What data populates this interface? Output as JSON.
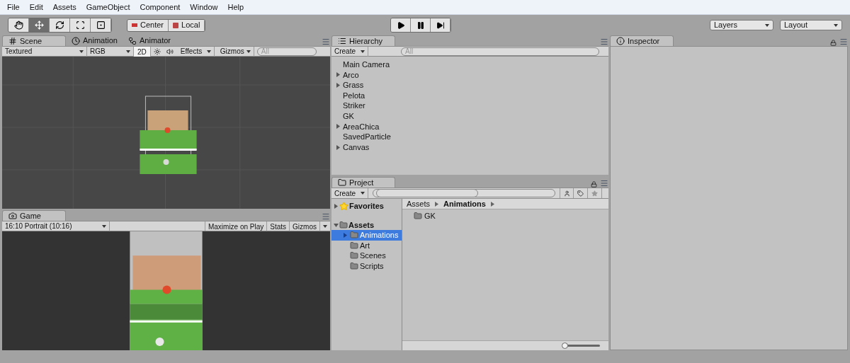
{
  "menu": [
    "File",
    "Edit",
    "Assets",
    "GameObject",
    "Component",
    "Window",
    "Help"
  ],
  "tools": [
    {
      "kind": "hand",
      "selected": false
    },
    {
      "kind": "move",
      "selected": true
    },
    {
      "kind": "rotate",
      "selected": false
    },
    {
      "kind": "scale",
      "selected": false
    },
    {
      "kind": "rect",
      "selected": false
    }
  ],
  "pivot": [
    {
      "kind": "center",
      "label": "Center"
    },
    {
      "kind": "local",
      "label": "Local"
    }
  ],
  "playback": [
    {
      "kind": "play"
    },
    {
      "kind": "pause"
    },
    {
      "kind": "step"
    }
  ],
  "layers": "Layers",
  "layout": "Layout",
  "scene_panel": {
    "tabs": [
      {
        "kind": "scene",
        "label": "Scene",
        "selected": true
      },
      {
        "kind": "animation",
        "label": "Animation",
        "selected": false
      },
      {
        "kind": "animator",
        "label": "Animator",
        "selected": false
      }
    ],
    "draw_mode": "Textured",
    "render_mode": "RGB",
    "mode_2d": {
      "label": "2D",
      "on": true
    },
    "effects": "Effects",
    "gizmos": "Gizmos",
    "search_placeholder": "All"
  },
  "game_panel": {
    "tab": "Game",
    "aspect": "16:10 Portrait (10:16)",
    "buttons": [
      "Maximize on Play",
      "Stats",
      "Gizmos"
    ]
  },
  "hierarchy": {
    "tab": "Hierarchy",
    "create": "Create",
    "search_placeholder": "All",
    "items": [
      {
        "label": "Main Camera",
        "has_children": false
      },
      {
        "label": "Arco",
        "has_children": true
      },
      {
        "label": "Grass",
        "has_children": true
      },
      {
        "label": "Pelota",
        "has_children": false
      },
      {
        "label": "Striker",
        "has_children": false
      },
      {
        "label": "GK",
        "has_children": false
      },
      {
        "label": "AreaChica",
        "has_children": true
      },
      {
        "label": "SavedParticle",
        "has_children": false
      },
      {
        "label": "Canvas",
        "has_children": true
      }
    ]
  },
  "project": {
    "tab": "Project",
    "create": "Create",
    "favorites": {
      "label": "Favorites",
      "expanded": false
    },
    "assets": {
      "label": "Assets",
      "expanded": true,
      "children": [
        {
          "label": "Animations",
          "selected": true,
          "has_children": true
        },
        {
          "label": "Art",
          "selected": false,
          "has_children": false
        },
        {
          "label": "Scenes",
          "selected": false,
          "has_children": false
        },
        {
          "label": "Scripts",
          "selected": false,
          "has_children": false
        }
      ]
    },
    "breadcrumb": [
      "Assets",
      "Animations"
    ],
    "items": [
      {
        "label": "GK"
      }
    ],
    "zoom_slider": {
      "level": 0.0
    }
  },
  "inspector": {
    "tab": "Inspector"
  }
}
